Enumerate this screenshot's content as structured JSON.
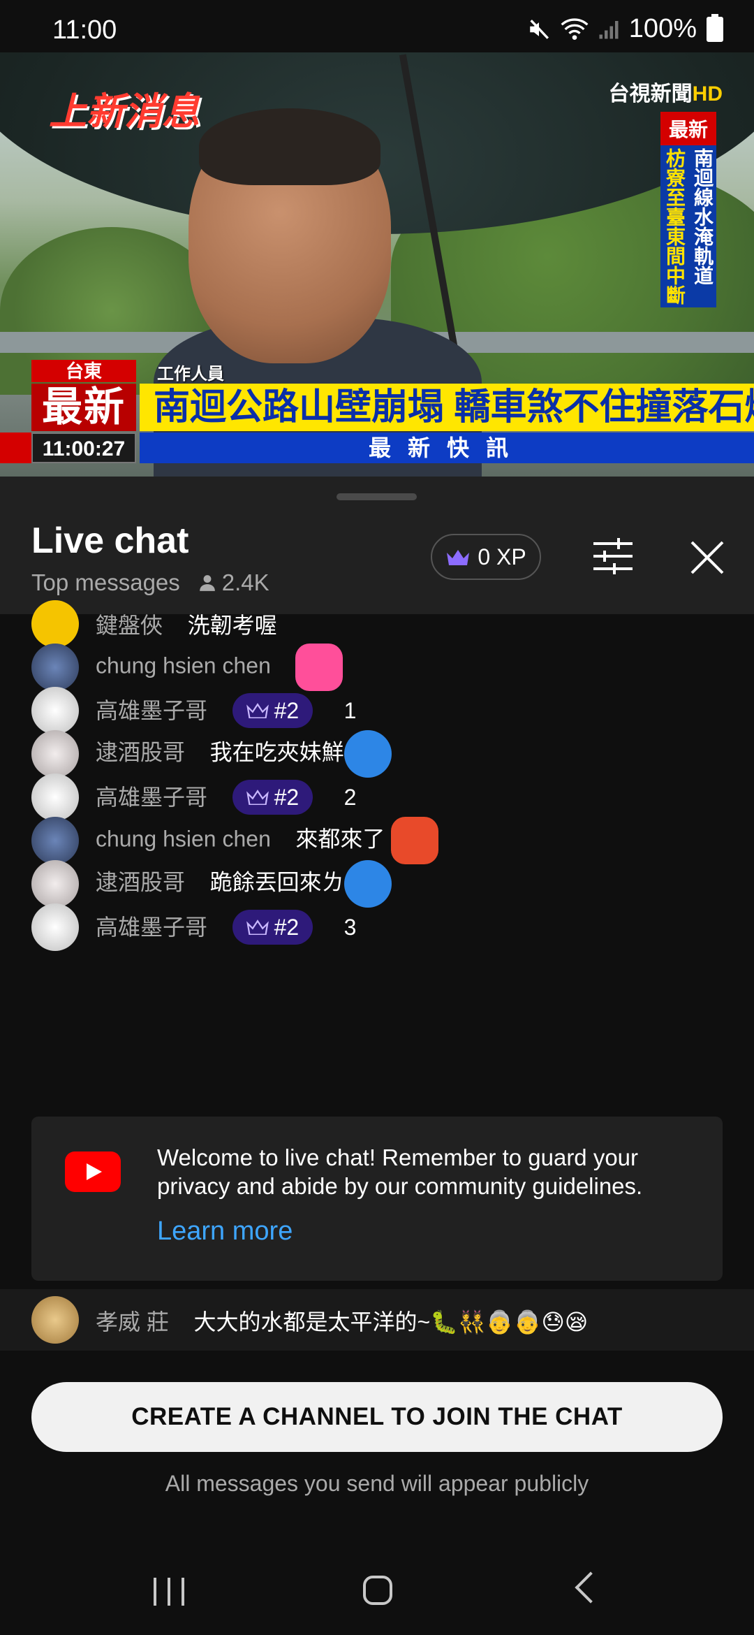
{
  "status_bar": {
    "time": "11:00",
    "battery": "100%"
  },
  "video": {
    "logo_left_a": "上新",
    "logo_left_b": "消息",
    "channel_name": "台視新聞",
    "channel_hd": "HD",
    "side_label": "最新",
    "side_col1": "南迴線水淹軌道",
    "side_col2": "枋寮至臺東間中斷",
    "location": "台東",
    "role": "工作人員",
    "latest": "最新",
    "headline": "南迴公路山壁崩塌 轎車煞不住撞落石爆胎",
    "clock": "11:00:27",
    "flash": "最新快訊"
  },
  "chat": {
    "title": "Live chat",
    "mode": "Top messages",
    "viewers": "2.4K",
    "xp": "0 XP"
  },
  "messages": [
    {
      "author": "鍵盤俠",
      "text": "洗韌考喔",
      "avatar_color": "#f5c400"
    },
    {
      "author": "chung hsien chen",
      "text": "",
      "badge": "",
      "avatar_color": "#3a4a6e",
      "emoji_color": "#ff4f9a"
    },
    {
      "author": "高雄墨子哥",
      "badge": "#2",
      "text": "1",
      "avatar_color": "#d9d9d9"
    },
    {
      "author": "逮酒股哥",
      "text": "我在吃夾妹鮮",
      "avatar_color": "#c9c4c4",
      "emoji_color": "#2d86e6"
    },
    {
      "author": "高雄墨子哥",
      "badge": "#2",
      "text": "2",
      "avatar_color": "#d9d9d9"
    },
    {
      "author": "chung hsien chen",
      "text": "來都來了",
      "avatar_color": "#3a4a6e",
      "emoji_color": "#e84a2a"
    },
    {
      "author": "逮酒股哥",
      "text": "跪餘丟回來ㄌ",
      "avatar_color": "#c9c4c4",
      "emoji_color": "#2d86e6"
    },
    {
      "author": "高雄墨子哥",
      "badge": "#2",
      "text": "3",
      "avatar_color": "#d9d9d9"
    }
  ],
  "welcome": {
    "text": "Welcome to live chat! Remember to guard your privacy and abide by our community guidelines.",
    "learn_more": "Learn more"
  },
  "pinned": {
    "author": "孝威 莊",
    "text": "大大的水都是太平洋的~🐛👯👵👵😓😪",
    "avatar_color": "#d8b070"
  },
  "footer": {
    "create_button": "CREATE A CHANNEL TO JOIN THE CHAT",
    "note": "All messages you send will appear publicly"
  }
}
